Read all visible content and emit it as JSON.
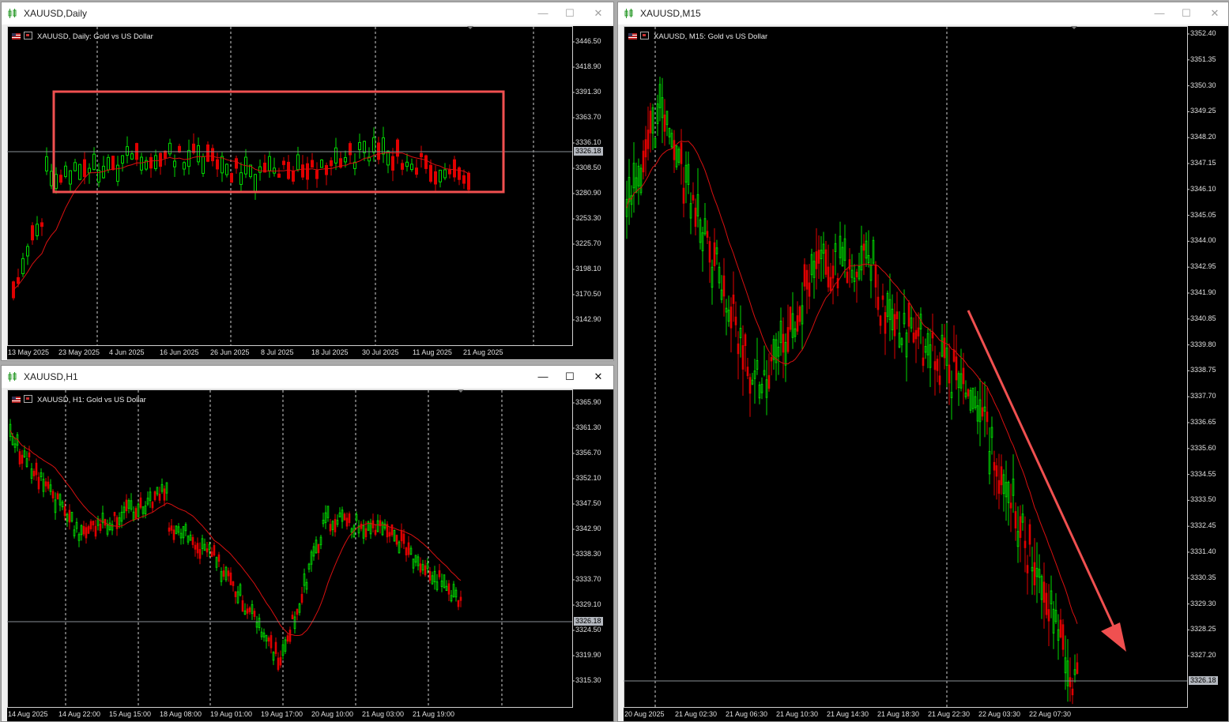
{
  "windows": {
    "daily": {
      "title": "XAUUSD,Daily",
      "header_symbol": "XAUUSD, Daily:",
      "header_desc": "Gold vs US Dollar",
      "current_price": "3326.18",
      "y_labels": [
        "3446.50",
        "3418.90",
        "3391.30",
        "3363.70",
        "3336.10",
        "3308.50",
        "3280.90",
        "3253.30",
        "3225.70",
        "3198.10",
        "3170.50",
        "3142.90"
      ],
      "x_labels": [
        "13 May 2025",
        "23 May 2025",
        "4 Jun 2025",
        "16 Jun 2025",
        "26 Jun 2025",
        "8 Jul 2025",
        "18 Jul 2025",
        "30 Jul 2025",
        "11 Aug 2025",
        "21 Aug 2025"
      ]
    },
    "h1": {
      "title": "XAUUSD,H1",
      "header_symbol": "XAUUSD, H1:",
      "header_desc": "Gold vs US Dollar",
      "current_price": "3326.18",
      "y_labels": [
        "3365.90",
        "3361.30",
        "3356.70",
        "3352.10",
        "3347.50",
        "3342.90",
        "3338.30",
        "3333.70",
        "3329.10",
        "3324.50",
        "3319.90",
        "3315.30"
      ],
      "x_labels": [
        "14 Aug 2025",
        "14 Aug 22:00",
        "15 Aug 15:00",
        "18 Aug 08:00",
        "19 Aug 01:00",
        "19 Aug 17:00",
        "20 Aug 10:00",
        "21 Aug 03:00",
        "21 Aug 19:00"
      ]
    },
    "m15": {
      "title": "XAUUSD,M15",
      "header_symbol": "XAUUSD, M15:",
      "header_desc": "Gold vs US Dollar",
      "current_price": "3326.18",
      "y_labels": [
        "3352.40",
        "3351.35",
        "3350.30",
        "3349.25",
        "3348.20",
        "3347.15",
        "3346.10",
        "3345.05",
        "3344.00",
        "3342.95",
        "3341.90",
        "3340.85",
        "3339.80",
        "3338.75",
        "3337.70",
        "3336.65",
        "3335.60",
        "3334.55",
        "3333.50",
        "3332.45",
        "3331.40",
        "3330.35",
        "3329.30",
        "3328.25",
        "3327.20"
      ],
      "x_labels": [
        "20 Aug 2025",
        "21 Aug 02:30",
        "21 Aug 06:30",
        "21 Aug 10:30",
        "21 Aug 14:30",
        "21 Aug 18:30",
        "21 Aug 22:30",
        "22 Aug 03:30",
        "22 Aug 07:30"
      ]
    }
  },
  "window_controls": {
    "minimize": "—",
    "maximize": "☐",
    "close": "✕"
  },
  "colors": {
    "bull": "#00d800",
    "bear": "#e00000",
    "ma": "#d81010",
    "annotation": "#f05050",
    "grid": "#cfcfcf"
  }
}
